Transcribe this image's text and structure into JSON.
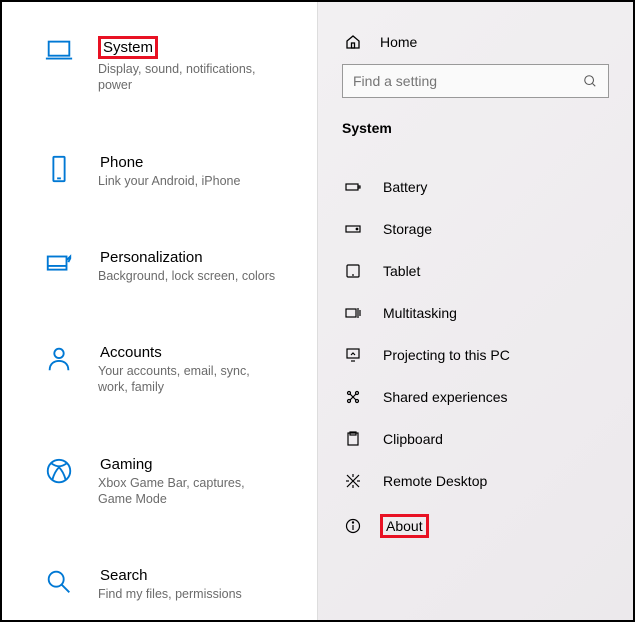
{
  "left": {
    "items": [
      {
        "title": "System",
        "desc": "Display, sound, notifications, power",
        "highlighted": true
      },
      {
        "title": "Phone",
        "desc": "Link your Android, iPhone"
      },
      {
        "title": "Personalization",
        "desc": "Background, lock screen, colors"
      },
      {
        "title": "Accounts",
        "desc": "Your accounts, email, sync, work, family"
      },
      {
        "title": "Gaming",
        "desc": "Xbox Game Bar, captures, Game Mode"
      },
      {
        "title": "Search",
        "desc": "Find my files, permissions"
      }
    ]
  },
  "right": {
    "home_label": "Home",
    "search_placeholder": "Find a setting",
    "section_header": "System",
    "items": [
      {
        "label": "Battery"
      },
      {
        "label": "Storage"
      },
      {
        "label": "Tablet"
      },
      {
        "label": "Multitasking"
      },
      {
        "label": "Projecting to this PC"
      },
      {
        "label": "Shared experiences"
      },
      {
        "label": "Clipboard"
      },
      {
        "label": "Remote Desktop"
      },
      {
        "label": "About",
        "highlighted": true
      }
    ]
  }
}
